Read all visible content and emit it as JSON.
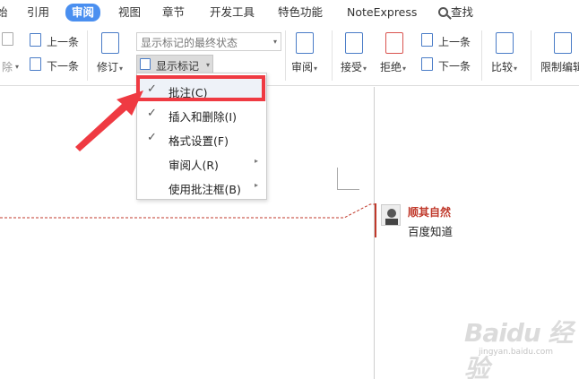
{
  "tabs": [
    {
      "label": "引用",
      "active": false
    },
    {
      "label": "审阅",
      "active": true
    },
    {
      "label": "视图",
      "active": false
    },
    {
      "label": "章节",
      "active": false
    },
    {
      "label": "开发工具",
      "active": false
    },
    {
      "label": "特色功能",
      "active": false
    },
    {
      "label": "NoteExpress",
      "active": false
    }
  ],
  "search_label": "查找",
  "ribbon": {
    "prev_comment": "上一条",
    "next_comment": "下一条",
    "delete_partial": "除",
    "track_changes": "修订",
    "display_mode": "显示标记的最终状态",
    "show_markup": "显示标记",
    "reviewing_pane": "审阅",
    "accept": "接受",
    "reject": "拒绝",
    "prev_change": "上一条",
    "next_change": "下一条",
    "compare": "比较",
    "restrict_editing": "限制编辑"
  },
  "menu": {
    "items": [
      {
        "label": "批注(C)",
        "checked": true,
        "submenu": false
      },
      {
        "label": "插入和删除(I)",
        "checked": true,
        "submenu": false
      },
      {
        "label": "格式设置(F)",
        "checked": true,
        "submenu": false
      },
      {
        "label": "审阅人(R)",
        "checked": false,
        "submenu": true
      },
      {
        "label": "使用批注框(B)",
        "checked": false,
        "submenu": true
      }
    ]
  },
  "comment": {
    "author": "顺其自然",
    "text": "百度知道"
  },
  "watermark": {
    "brand": "Baidu 经验",
    "url": "jingyan.baidu.com"
  },
  "colors": {
    "accent": "#4a8ff0",
    "annotation_red": "#ef3a42",
    "comment_red": "#c0392b"
  }
}
